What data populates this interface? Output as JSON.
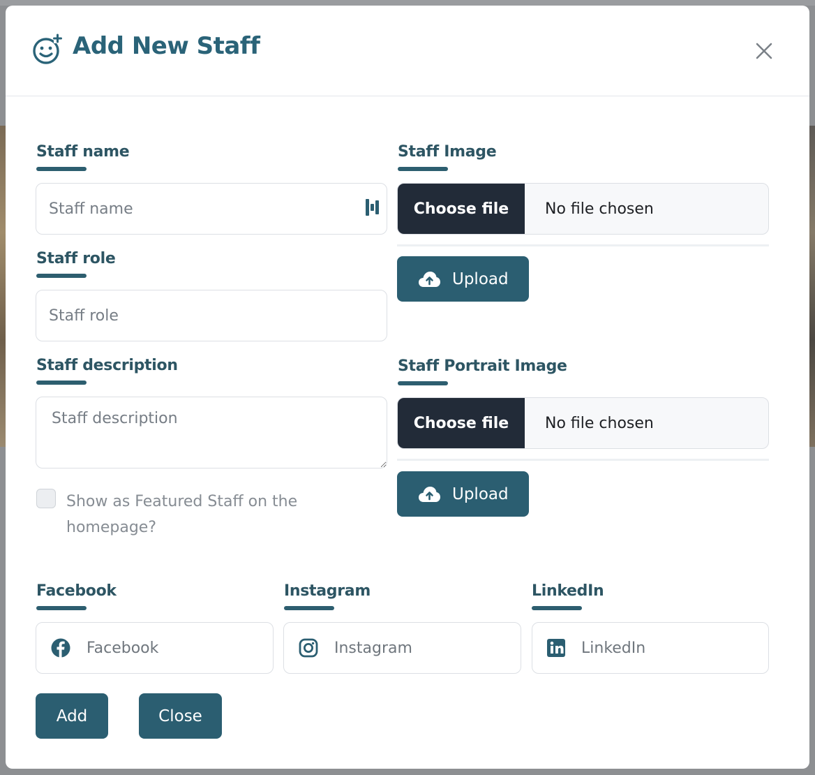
{
  "modal": {
    "title": "Add New Staff"
  },
  "form": {
    "staff_name": {
      "label": "Staff name",
      "placeholder": "Staff name"
    },
    "staff_role": {
      "label": "Staff role",
      "placeholder": "Staff role"
    },
    "staff_description": {
      "label": "Staff description",
      "placeholder": "Staff description"
    },
    "featured_checkbox": {
      "label": "Show as Featured Staff on the homepage?",
      "checked": false
    },
    "staff_image": {
      "label": "Staff Image",
      "choose_label": "Choose file",
      "status": "No file chosen",
      "upload_label": "Upload"
    },
    "staff_portrait_image": {
      "label": "Staff Portrait Image",
      "choose_label": "Choose file",
      "status": "No file chosen",
      "upload_label": "Upload"
    },
    "facebook": {
      "label": "Facebook",
      "placeholder": "Facebook",
      "icon": "facebook-icon"
    },
    "instagram": {
      "label": "Instagram",
      "placeholder": "Instagram",
      "icon": "instagram-icon"
    },
    "linkedin": {
      "label": "LinkedIn",
      "placeholder": "LinkedIn",
      "icon": "linkedin-icon"
    }
  },
  "actions": {
    "add_label": "Add",
    "close_label": "Close"
  },
  "colors": {
    "accent": "#2b5e71",
    "title": "#2a6378",
    "label": "#2d5563",
    "file_button": "#222b38"
  }
}
